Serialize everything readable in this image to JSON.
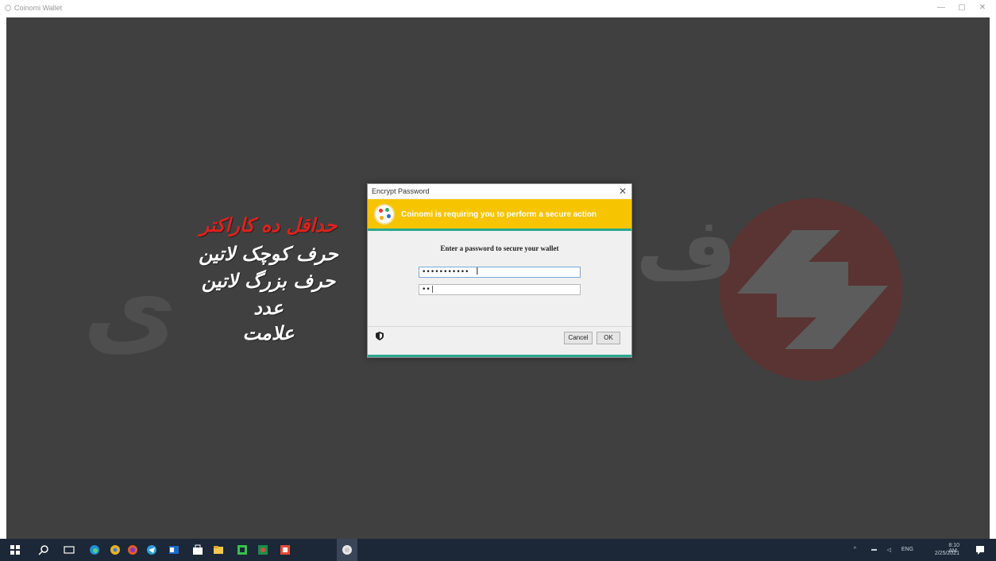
{
  "window": {
    "title": "Coinomi Wallet",
    "minimize_glyph": "—",
    "maximize_glyph": "▢",
    "close_glyph": "✕"
  },
  "overlay_captions": [
    "حداقل ده کاراکتر",
    "حرف کوچک لاتین",
    "حرف بزرگ لاتین",
    "عدد",
    "علامت"
  ],
  "watermark": {
    "letter_fa": "ف",
    "left_text": "ی"
  },
  "dialog": {
    "title": "Encrypt Password",
    "close_glyph": "✕",
    "banner_text": "Coinomi is requiring you to perform a secure action",
    "prompt": "Enter a password to secure your wallet",
    "password_value": "•••••••••••",
    "confirm_value": "••|",
    "cancel_label": "Cancel",
    "ok_label": "OK"
  },
  "taskbar": {
    "time": "8:10 AM",
    "date": "2/25/2021",
    "lang": "ENG",
    "icons": [
      "windows-start-icon",
      "search-icon",
      "task-view-icon",
      "edge-icon",
      "chrome-icon",
      "firefox-icon",
      "telegram-icon",
      "outlook-icon",
      "store-icon",
      "explorer-icon",
      "green-app-icon",
      "green-app-icon-2",
      "red-app-icon",
      "coinomi-app-icon"
    ]
  },
  "colors": {
    "banner": "#f6c400",
    "accent_teal": "#2aa890",
    "caption_red": "#e0211d",
    "canvas": "#404040"
  }
}
